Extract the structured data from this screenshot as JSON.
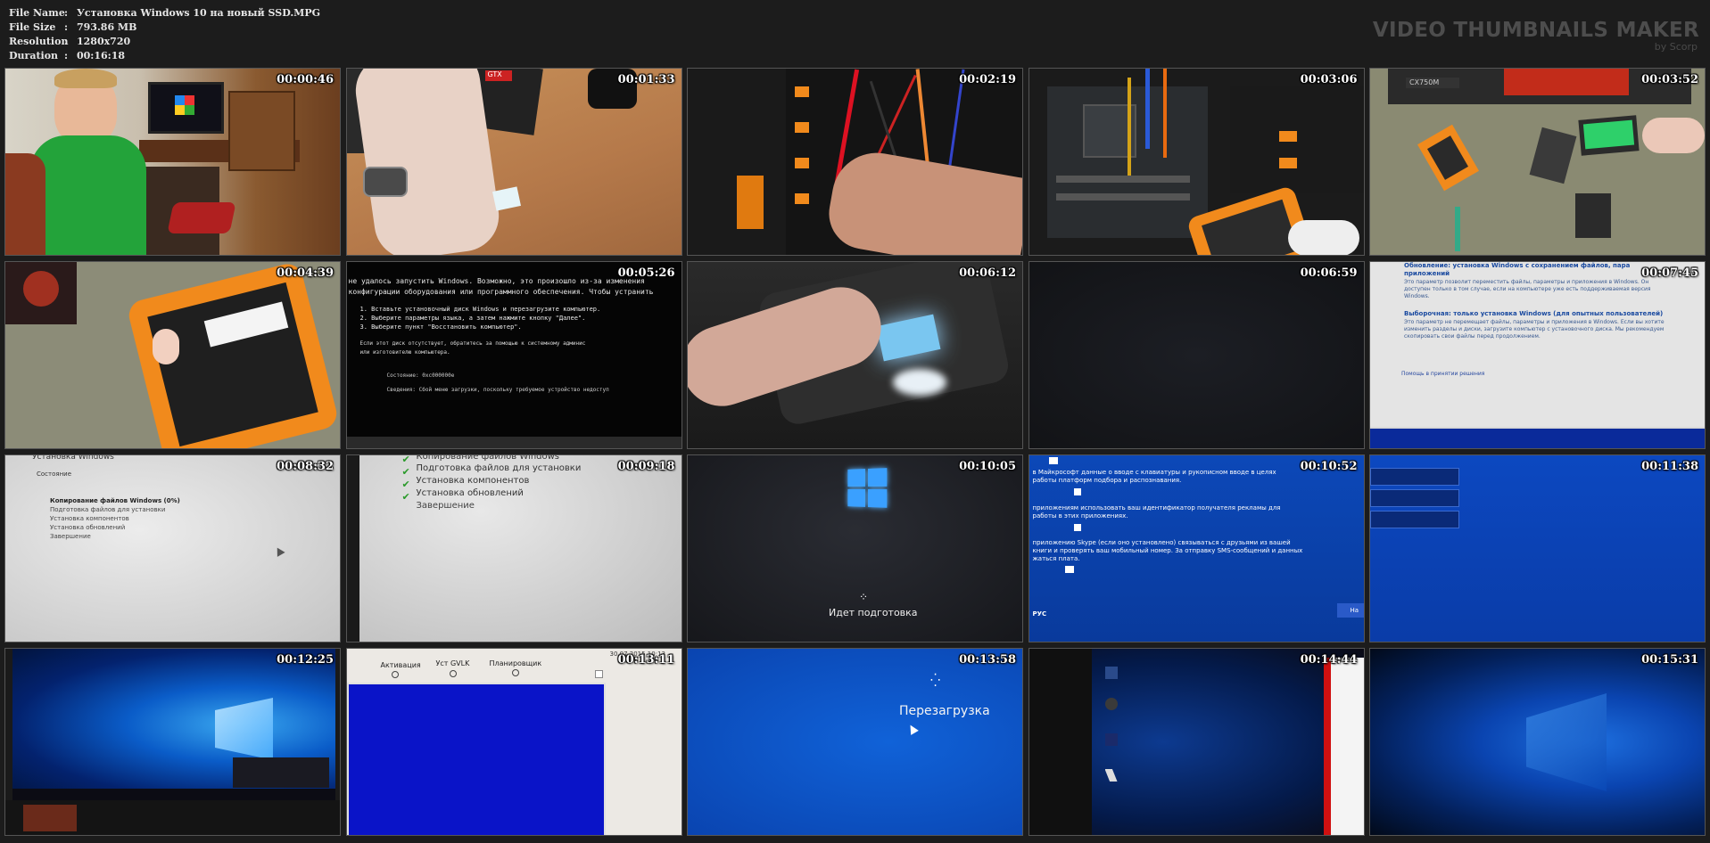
{
  "meta": {
    "file_name_label": "File Name",
    "file_name": "Установка Windows 10 на новый SSD.MPG",
    "file_size_label": "File Size",
    "file_size": "793.86 MB",
    "resolution_label": "Resolution",
    "resolution": "1280x720",
    "duration_label": "Duration",
    "duration": "00:16:18",
    "separator": ":"
  },
  "brand": {
    "title": "VIDEO THUMBNAILS MAKER",
    "subtitle": "by Scorp"
  },
  "thumbnails": [
    {
      "time": "00:00:46"
    },
    {
      "time": "00:01:33"
    },
    {
      "time": "00:02:19"
    },
    {
      "time": "00:03:06"
    },
    {
      "time": "00:03:52"
    },
    {
      "time": "00:04:39"
    },
    {
      "time": "00:05:26"
    },
    {
      "time": "00:06:12"
    },
    {
      "time": "00:06:59"
    },
    {
      "time": "00:07:45"
    },
    {
      "time": "00:08:32"
    },
    {
      "time": "00:09:18"
    },
    {
      "time": "00:10:05"
    },
    {
      "time": "00:10:52"
    },
    {
      "time": "00:11:38"
    },
    {
      "time": "00:12:25"
    },
    {
      "time": "00:13:11"
    },
    {
      "time": "00:13:58"
    },
    {
      "time": "00:14:44"
    },
    {
      "time": "00:15:31"
    }
  ],
  "frame_text": {
    "f7_lines": [
      "не удалось запустить Windows. Возможно, это произошло из-за изменения",
      "конфигурации оборудования или программного обеспечения. Чтобы устранить",
      "1. Вставьте установочный диск Windows и перезагрузите компьютер.",
      "2. Выберите параметры языка, а затем нажмите кнопку \"Далее\".",
      "3. Выберите пункт \"Восстановить компьютер\".",
      "Если этот диск отсутствует, обратитесь за помощью к системному админис",
      "или изготовителю компьютера.",
      "Состояние: 0xc000000e",
      "Сведения: Сбой меню загрузки, поскольку требуемое устройство недоступ"
    ],
    "f10_lines": [
      "Обновление: установка Windows с сохранением файлов, пара",
      "приложений",
      "Это параметр позволит переместить файлы, параметры и приложения в Windows. Он",
      "доступен только в том случае, если на компьютере уже есть поддерживаемая версия",
      "Windows.",
      "Выборочная: только установка Windows (для опытных пользователей)",
      "Это параметр не перемещает файлы, параметры и приложения в Windows. Если вы хотите",
      "изменить разделы и диски, загрузите компьютер с установочного диска. Мы рекомендуем",
      "скопировать свои файлы перед продолжением.",
      "Помощь в принятии решения"
    ],
    "f11_lines": [
      "Установка Windows",
      "Состояние",
      "Копирование файлов Windows (0%)",
      "Подготовка файлов для установки",
      "Установка компонентов",
      "Установка обновлений",
      "Завершение"
    ],
    "f12_lines": [
      "Копирование файлов Windows",
      "Подготовка файлов для установки",
      "Установка компонентов",
      "Установка обновлений",
      "Завершение"
    ],
    "f13_text": "Идет подготовка",
    "f14_lines": [
      "в Майкрософт данные о вводе с клавиатуры и рукописном вводе в целях",
      "работы платформ подбора и распознавания.",
      "приложениям использовать ваш идентификатор получателя рекламы для",
      "работы в этих приложениях.",
      "приложению Skype (если оно установлено) связываться с друзьями из вашей",
      "книги и проверять ваш мобильный номер. За отправку SMS-сообщений и данных",
      "жаться плата.",
      "РУС",
      "На"
    ],
    "f17_tabs": [
      "Активация",
      "Уст GVLK",
      "Планировщик"
    ],
    "f17_date": "30.07.2015 10:13",
    "f18_text": "Перезагрузка",
    "f1_gpu": "GTX",
    "f3_case": "CX750M"
  },
  "colors": {
    "win_blue": "#0a3ea8",
    "orange": "#f18a1c",
    "bg": "#1c1c1c"
  }
}
